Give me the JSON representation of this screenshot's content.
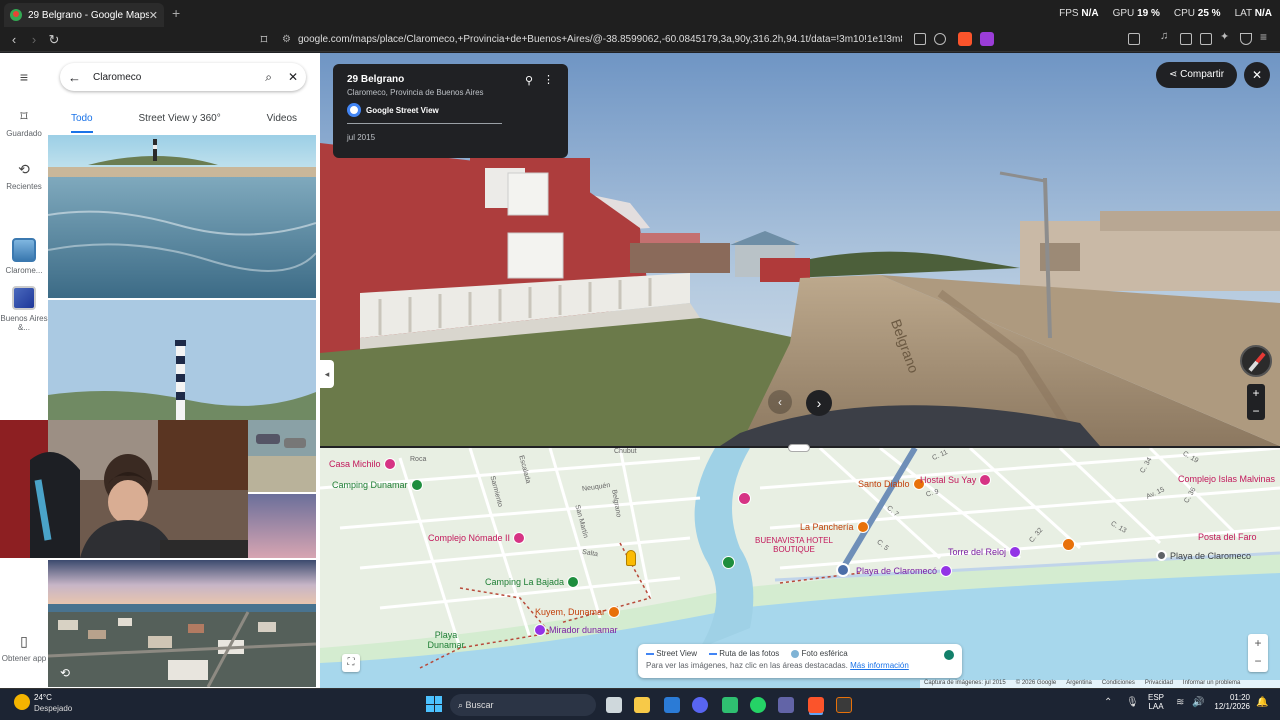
{
  "browser": {
    "tab_title": "29 Belgrano - Google Maps",
    "url": "google.com/maps/place/Claromeco,+Provincia+de+Buenos+Aires/@-38.8599062,-60.0845179,3a,90y,316.2h,94.1t/data=!3m10!1e1!3m8!1s5I1...",
    "perf": {
      "fps_label": "FPS",
      "fps": "N/A",
      "gpu_label": "GPU",
      "gpu": "19 %",
      "cpu_label": "CPU",
      "cpu": "25 %",
      "lat_label": "LAT",
      "lat": "N/A"
    }
  },
  "rail": {
    "menu_icon": "menu-icon",
    "saved": "Guardado",
    "recent": "Recientes",
    "claromeco": "Clarome...",
    "buenos_aires": "Buenos Aires &...",
    "get_app": "Obtener app"
  },
  "search": {
    "query": "Claromeco",
    "tabs": [
      "Todo",
      "Street View y 360°",
      "Videos"
    ]
  },
  "streetview": {
    "place": "29 Belgrano",
    "address": "Claromeco, Provincia de Buenos Aires",
    "source": "Google Street View",
    "date": "jul 2015",
    "share": "Compartir",
    "street_sign": "Belgrano"
  },
  "map": {
    "places": [
      {
        "name": "Casa Michilo",
        "color": "#d63384"
      },
      {
        "name": "Camping Dunamar",
        "color": "#1e8e3e"
      },
      {
        "name": "Complejo Nómade II",
        "color": "#d63384"
      },
      {
        "name": "Camping La Bajada",
        "color": "#1e8e3e"
      },
      {
        "name": "Kuyem, Dunamar",
        "color": "#e8710a"
      },
      {
        "name": "Mirador dunamar",
        "color": "#9334e6"
      },
      {
        "name": "Playa Dunamar",
        "color": "#1e8e3e"
      },
      {
        "name": "Santo Diablo",
        "color": "#e8710a"
      },
      {
        "name": "Hostal Su Yay",
        "color": "#d63384"
      },
      {
        "name": "La Panchería",
        "color": "#e8710a"
      },
      {
        "name": "BUENAVISTA HOTEL BOUTIQUE",
        "color": "#d63384"
      },
      {
        "name": "Playa de Claromecó",
        "color": "#9334e6"
      },
      {
        "name": "Torre del Reloj",
        "color": "#9334e6"
      },
      {
        "name": "Complejo Islas Malvinas",
        "color": "#d63384"
      },
      {
        "name": "Posta del Faro",
        "color": "#d63384"
      },
      {
        "name": "Playa de Claromeco",
        "color": "#5f6368"
      }
    ],
    "streets": [
      "Roca",
      "Chubut",
      "Neuquén",
      "Escalada",
      "Sarmiento",
      "San Martín",
      "Belgrano",
      "Salta",
      "C. 5",
      "C. 7",
      "C. 9",
      "C. 11",
      "C. 13",
      "C. 19",
      "C. 32",
      "C. 34",
      "C. 36",
      "Av. 15"
    ],
    "legend": {
      "street_view": "Street View",
      "photo_route": "Ruta de las fotos",
      "spherical": "Foto esférica",
      "hint": "Para ver las imágenes, haz clic en las áreas destacadas.",
      "more_info": "Más información"
    },
    "attribution": [
      "Captura de imágenes: jul 2015",
      "© 2026 Google",
      "Argentina",
      "Condiciones",
      "Privacidad",
      "Informar un problema"
    ]
  },
  "taskbar": {
    "temp": "24°C",
    "weather": "Despejado",
    "search": "Buscar",
    "lang1": "ESP",
    "lang2": "LAA",
    "time": "01:20",
    "date": "12/1/2026"
  }
}
